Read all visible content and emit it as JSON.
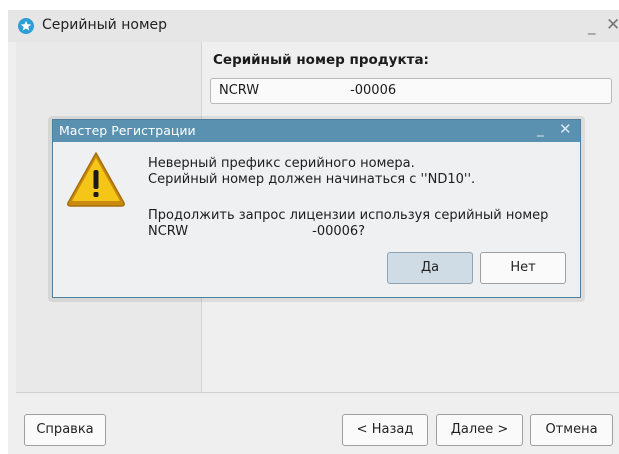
{
  "window": {
    "title": "Серийный номер",
    "minimize": "_",
    "close": "✕"
  },
  "form": {
    "serial_label": "Серийный номер продукта:",
    "serial_value": "NCRW                      -00006"
  },
  "buttons": {
    "help": "Справка",
    "back": "< Назад",
    "next": "Далее >",
    "cancel": "Отмена"
  },
  "dialog": {
    "title": "Мастер Регистрации",
    "minimize": "_",
    "close": "✕",
    "icon": "warning-icon",
    "line1": "Неверный префикс серийного номера.",
    "line2": "Серийный номер должен начинаться с ''ND10''.",
    "line3": "Продолжить запрос лицензии используя серийный номер",
    "line4": "NCRW                              -00006?",
    "yes": "Да",
    "no": "Нет"
  },
  "colors": {
    "dialog_titlebar": "#5a91b1",
    "warning_fill": "#f5c518",
    "app_icon": "#2e9fd6"
  }
}
